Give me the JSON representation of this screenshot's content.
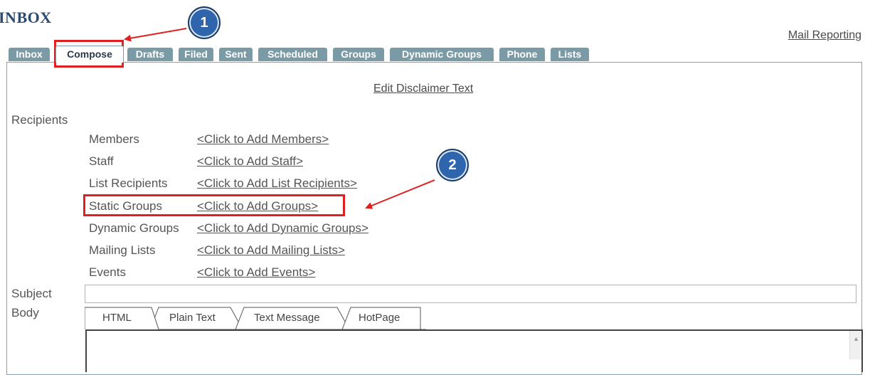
{
  "header": {
    "title": "INBOX",
    "mail_reporting": "Mail Reporting"
  },
  "tabs": [
    {
      "label": "Inbox",
      "active": false
    },
    {
      "label": "Compose",
      "active": true
    },
    {
      "label": "Drafts",
      "active": false
    },
    {
      "label": "Filed",
      "active": false
    },
    {
      "label": "Sent",
      "active": false
    },
    {
      "label": "Scheduled",
      "active": false
    },
    {
      "label": "Groups",
      "active": false
    },
    {
      "label": "Dynamic Groups",
      "active": false
    },
    {
      "label": "Phone",
      "active": false
    },
    {
      "label": "Lists",
      "active": false
    }
  ],
  "compose": {
    "disclaimer_link": "Edit Disclaimer Text",
    "recipients_label": "Recipients",
    "recipients": [
      {
        "label": "Members",
        "link": "<Click to Add Members>"
      },
      {
        "label": "Staff",
        "link": "<Click to Add Staff>"
      },
      {
        "label": "List Recipients",
        "link": "<Click to Add List Recipients>"
      },
      {
        "label": "Static Groups",
        "link": "<Click to Add Groups>"
      },
      {
        "label": "Dynamic Groups",
        "link": "<Click to Add Dynamic Groups>"
      },
      {
        "label": "Mailing Lists",
        "link": "<Click to Add Mailing Lists>"
      },
      {
        "label": "Events",
        "link": "<Click to Add Events>"
      }
    ],
    "subject_label": "Subject",
    "subject_value": "",
    "body_label": "Body",
    "editor_tabs": [
      {
        "label": "HTML",
        "active": true
      },
      {
        "label": "Plain Text",
        "active": false
      },
      {
        "label": "Text Message",
        "active": false
      },
      {
        "label": "HotPage",
        "active": false
      }
    ]
  },
  "annotations": {
    "badge1": "1",
    "badge2": "2",
    "highlight_color": "#e02020",
    "badge_color": "#2f65ad"
  }
}
